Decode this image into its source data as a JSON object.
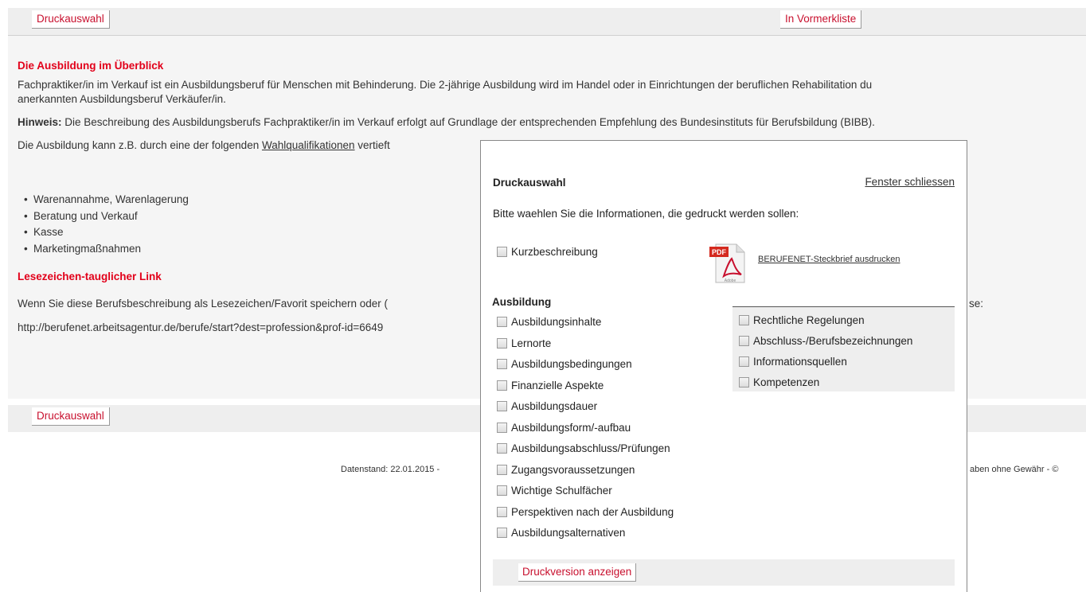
{
  "top_bar": {
    "print_label": "Druckauswahl",
    "watchlist_label": "In Vormerkliste"
  },
  "bottom_bar": {
    "print_label": "Druckauswahl"
  },
  "main": {
    "overview_heading": "Die Ausbildung im Überblick",
    "intro_line1": "Fachpraktiker/in im Verkauf ist ein Ausbildungsberuf für Menschen mit Behinderung. Die 2-jährige Ausbildung wird im Handel oder in Einrichtungen der beruflichen Rehabilitation du",
    "intro_line2": "anerkannten Ausbildungsberuf Verkäufer/in.",
    "hint_label": "Hinweis:",
    "hint_text": " Die Beschreibung des Ausbildungsberufs Fachpraktiker/in im Verkauf erfolgt auf Grundlage der entsprechenden Empfehlung des Bundesinstituts für Berufsbildung (BIBB).",
    "wahl_prefix": "Die Ausbildung kann z.B. durch eine der folgenden ",
    "wahl_link": "Wahlqualifikationen",
    "wahl_suffix": " vertieft",
    "list": [
      "Warenannahme, Warenlagerung",
      "Beratung und Verkauf",
      "Kasse",
      "Marketingmaßnahmen"
    ],
    "bookmark_heading": "Lesezeichen-tauglicher Link",
    "bookmark_text_left": "Wenn Sie diese Berufsbeschreibung als Lesezeichen/Favorit speichern oder (",
    "bookmark_text_right": "se:",
    "bookmark_url": "http://berufenet.arbeitsagentur.de/berufe/start?dest=profession&prof-id=6649"
  },
  "footer": {
    "left": "Datenstand: 22.01.2015  -",
    "right": "aben ohne Gewähr  - ©"
  },
  "dialog": {
    "title": "Druckauswahl",
    "close_label": "Fenster schliessen",
    "intro": "Bitte waehlen Sie die Informationen, die gedruckt werden sollen:",
    "short_desc": "Kurzbeschreibung",
    "pdf_link": "BERUFENET-Steckbrief ausdrucken",
    "section_heading": "Ausbildung",
    "left_items": [
      "Ausbildungsinhalte",
      "Lernorte",
      "Ausbildungsbedingungen",
      "Finanzielle Aspekte",
      "Ausbildungsdauer",
      "Ausbildungsform/-aufbau",
      "Ausbildungsabschluss/Prüfungen",
      "Zugangsvoraussetzungen",
      "Wichtige Schulfächer",
      "Perspektiven nach der Ausbildung",
      "Ausbildungsalternativen"
    ],
    "right_items": [
      "Rechtliche Regelungen",
      "Abschluss-/Berufsbezeichnungen",
      "Informationsquellen",
      "Kompetenzen"
    ],
    "submit_label": "Druckversion anzeigen"
  }
}
